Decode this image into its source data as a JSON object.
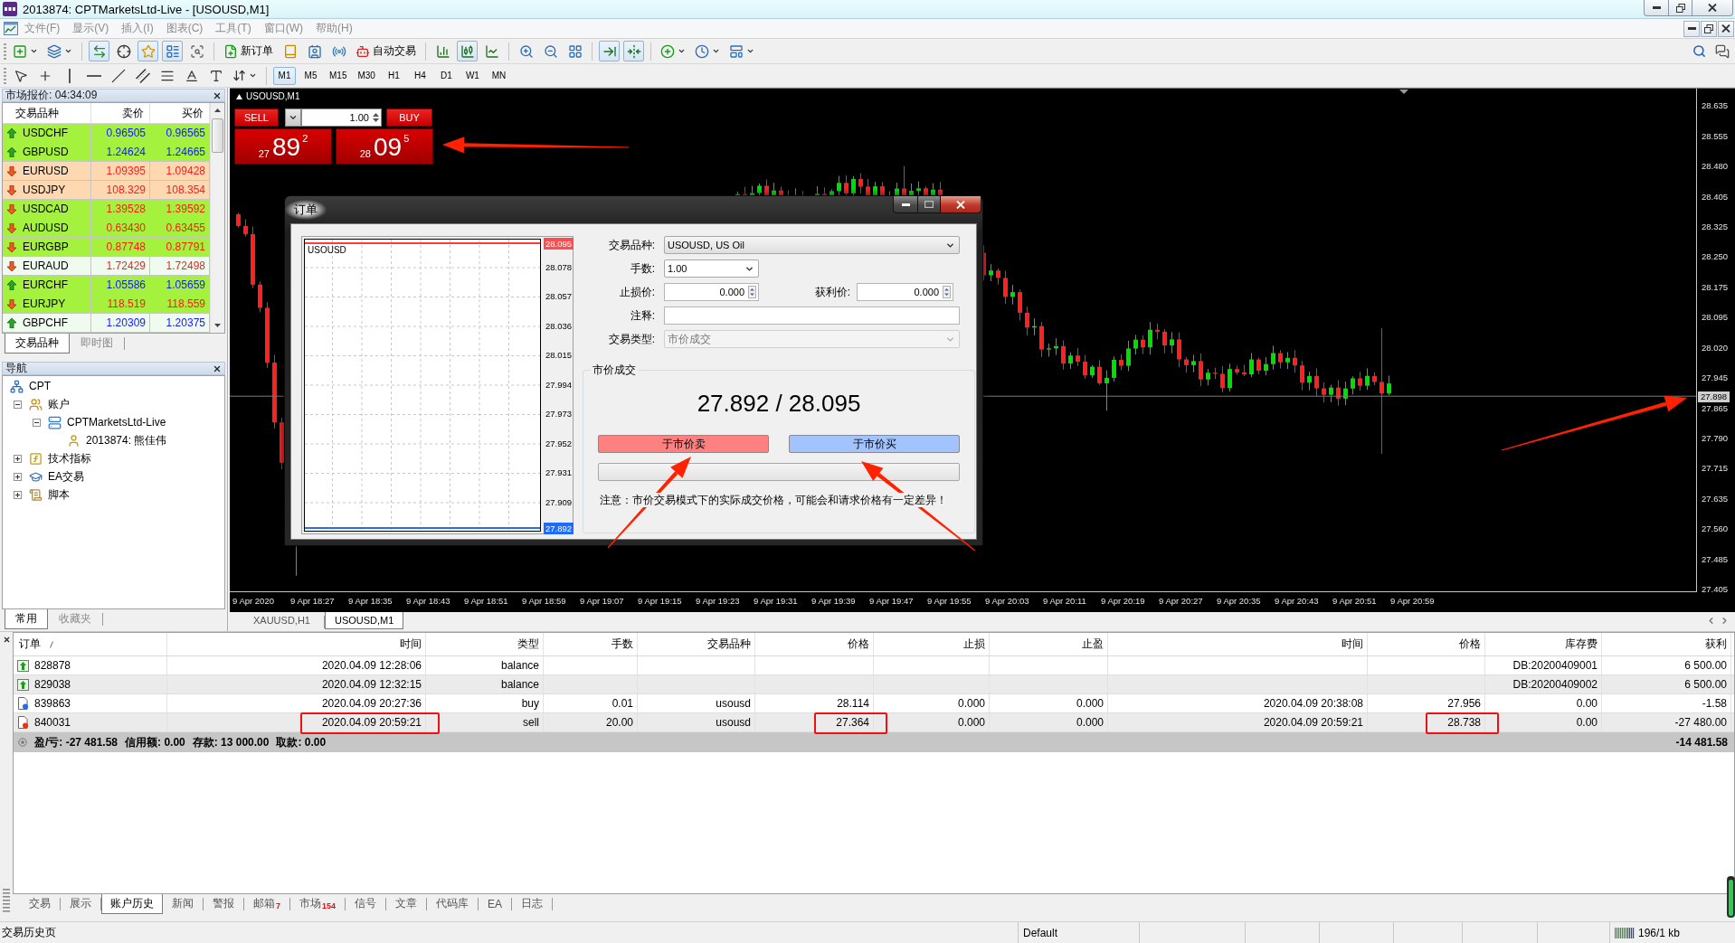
{
  "window": {
    "title": "2013874: CPTMarketsLtd-Live - [USOUSD,M1]"
  },
  "menu": [
    {
      "label": "文件(F)",
      "disabled": true
    },
    {
      "label": "显示(V)",
      "disabled": true
    },
    {
      "label": "插入(I)",
      "disabled": true
    },
    {
      "label": "图表(C)",
      "disabled": true
    },
    {
      "label": "工具(T)",
      "disabled": true
    },
    {
      "label": "窗口(W)",
      "disabled": true
    },
    {
      "label": "帮助(H)",
      "disabled": true
    }
  ],
  "toolbar": {
    "groups": [
      [
        {
          "pressed": false
        },
        {
          "pressed": false
        }
      ],
      [
        {
          "pressed": true
        },
        {
          "pressed": false
        },
        {
          "pressed": true
        },
        {
          "pressed": true
        },
        {
          "pressed": false
        }
      ],
      [
        {
          "label": "新订单",
          "pressed": false
        },
        {
          "pressed": false
        },
        {
          "pressed": false
        },
        {
          "pressed": false
        },
        {
          "label": "自动交易",
          "pressed": false
        }
      ],
      [
        {
          "pressed": false
        },
        {
          "pressed": true
        },
        {
          "pressed": false
        }
      ],
      [
        {
          "pressed": false
        },
        {
          "pressed": false
        },
        {
          "pressed": false
        }
      ],
      [
        {
          "pressed": true
        },
        {
          "pressed": true
        }
      ],
      [
        {
          "pressed": false
        },
        {
          "pressed": false
        },
        {
          "pressed": false
        }
      ]
    ]
  },
  "timeframes": [
    {
      "label": "M1",
      "selected": true
    },
    {
      "label": "M5",
      "selected": false
    },
    {
      "label": "M15",
      "selected": false
    },
    {
      "label": "M30",
      "selected": false
    },
    {
      "label": "H1",
      "selected": false
    },
    {
      "label": "H4",
      "selected": false
    },
    {
      "label": "D1",
      "selected": false
    },
    {
      "label": "W1",
      "selected": false
    },
    {
      "label": "MN",
      "selected": false
    }
  ],
  "market_watch": {
    "title": "市场报价: 04:34:09",
    "columns": [
      "交易品种",
      "卖价",
      "买价"
    ],
    "rows": [
      {
        "symbol": "USDCHF",
        "bid": "0.96505",
        "ask": "0.96565",
        "rising": true,
        "color": "#a4f23e"
      },
      {
        "symbol": "GBPUSD",
        "bid": "1.24624",
        "ask": "1.24665",
        "rising": true,
        "color": "#a4f23e"
      },
      {
        "symbol": "EURUSD",
        "bid": "1.09395",
        "ask": "1.09428",
        "rising": false,
        "color": "#fdd8b0"
      },
      {
        "symbol": "USDJPY",
        "bid": "108.329",
        "ask": "108.354",
        "rising": false,
        "color": "#fdd8b0"
      },
      {
        "symbol": "USDCAD",
        "bid": "1.39528",
        "ask": "1.39592",
        "rising": false,
        "color": "#a4f23e"
      },
      {
        "symbol": "AUDUSD",
        "bid": "0.63430",
        "ask": "0.63455",
        "rising": false,
        "color": "#a4f23e"
      },
      {
        "symbol": "EURGBP",
        "bid": "0.87748",
        "ask": "0.87791",
        "rising": false,
        "color": "#a4f23e"
      },
      {
        "symbol": "EURAUD",
        "bid": "1.72429",
        "ask": "1.72498",
        "rising": false,
        "color": "#f0fbf0"
      },
      {
        "symbol": "EURCHF",
        "bid": "1.05586",
        "ask": "1.05659",
        "rising": true,
        "color": "#a4f23e"
      },
      {
        "symbol": "EURJPY",
        "bid": "118.519",
        "ask": "118.559",
        "rising": false,
        "color": "#a4f23e"
      },
      {
        "symbol": "GBPCHF",
        "bid": "1.20309",
        "ask": "1.20375",
        "rising": true,
        "color": "#f0fbf0"
      }
    ],
    "tabs": [
      {
        "label": "交易品种",
        "selected": true
      },
      {
        "label": "即时图",
        "selected": false
      }
    ]
  },
  "navigator": {
    "title": "导航",
    "tree": [
      {
        "label": "CPT",
        "kind": "network",
        "children": [
          {
            "label": "账户",
            "kind": "accounts",
            "expanded": true,
            "children": [
              {
                "label": "CPTMarketsLtd-Live",
                "kind": "server",
                "expanded": true,
                "children": [
                  {
                    "label": "2013874: 熊佳伟",
                    "kind": "user"
                  }
                ]
              }
            ]
          },
          {
            "label": "技术指标",
            "kind": "indicators",
            "expanded": false
          },
          {
            "label": "EA交易",
            "kind": "experts",
            "expanded": false
          },
          {
            "label": "脚本",
            "kind": "scripts",
            "expanded": false
          }
        ]
      }
    ],
    "tabs": [
      {
        "label": "常用",
        "selected": true
      },
      {
        "label": "收藏夹",
        "selected": false
      }
    ]
  },
  "chart": {
    "title": "USOUSD,M1",
    "price_axis": [
      "28.635",
      "28.555",
      "28.480",
      "28.405",
      "28.325",
      "28.250",
      "28.175",
      "28.095",
      "28.020",
      "27.945",
      "27.865",
      "27.790",
      "27.715",
      "27.635",
      "27.560",
      "27.485",
      "27.405"
    ],
    "current_price": "27.898",
    "time_axis": [
      "9 Apr 2020",
      "9 Apr 18:27",
      "9 Apr 18:35",
      "9 Apr 18:43",
      "9 Apr 18:51",
      "9 Apr 18:59",
      "9 Apr 19:07",
      "9 Apr 19:15",
      "9 Apr 19:23",
      "9 Apr 19:31",
      "9 Apr 19:39",
      "9 Apr 19:47",
      "9 Apr 19:55",
      "9 Apr 20:03",
      "9 Apr 20:11",
      "9 Apr 20:19",
      "9 Apr 20:27",
      "9 Apr 20:35",
      "9 Apr 20:43",
      "9 Apr 20:51",
      "9 Apr 20:59"
    ],
    "one_click": {
      "sell_label": "SELL",
      "buy_label": "BUY",
      "lots": "1.00",
      "sell_quote": {
        "head": "27",
        "big": "89",
        "tail": "2"
      },
      "buy_quote": {
        "head": "28",
        "big": "09",
        "tail": "5"
      }
    }
  },
  "chart_tabs": [
    {
      "label": "XAUUSD,H1",
      "selected": false
    },
    {
      "label": "USOUSD,M1",
      "selected": true
    }
  ],
  "order_dialog": {
    "title": "订单",
    "preview": {
      "symbol": "USOUSD",
      "ask": "28.095",
      "bid": "27.892",
      "labels": [
        "28.078",
        "28.057",
        "28.036",
        "28.015",
        "27.994",
        "27.973",
        "27.952",
        "27.931",
        "27.909"
      ]
    },
    "symbol": {
      "label": "交易品种:",
      "value": "USOUSD, US Oil"
    },
    "volume": {
      "label": "手数:",
      "value": "1.00"
    },
    "stop_loss": {
      "label": "止损价:",
      "value": "0.000"
    },
    "take_profit": {
      "label": "获利价:",
      "value": "0.000"
    },
    "comment": {
      "label": "注释:"
    },
    "order_type": {
      "label": "交易类型:",
      "value": "市价成交",
      "disabled": true
    },
    "market": {
      "title": "市价成交",
      "quote": "27.892 / 28.095",
      "sell_button": "于市价卖",
      "buy_button": "于市价买",
      "note": "注意：市价交易模式下的实际成交价格，可能会和请求价格有一定差异！"
    }
  },
  "terminal": {
    "columns": [
      {
        "label": "订单",
        "sorted": true
      },
      {
        "label": "时间",
        "sorted": false
      },
      {
        "label": "类型",
        "sorted": false
      },
      {
        "label": "手数",
        "sorted": false
      },
      {
        "label": "交易品种",
        "sorted": false
      },
      {
        "label": "价格",
        "sorted": false
      },
      {
        "label": "止损",
        "sorted": false
      },
      {
        "label": "止盈",
        "sorted": false
      },
      {
        "label": "时间",
        "sorted": false
      },
      {
        "label": "价格",
        "sorted": false
      },
      {
        "label": "库存费",
        "sorted": false
      },
      {
        "label": "获利",
        "sorted": false
      }
    ],
    "rows": [
      {
        "kind": "balance",
        "cells": [
          {
            "text": "828878",
            "boxed": false
          },
          {
            "text": "2020.04.09 12:28:06",
            "boxed": false
          },
          {
            "text": "balance",
            "boxed": false
          },
          null,
          null,
          null,
          null,
          null,
          null,
          null,
          {
            "text": "DB:20200409001",
            "boxed": false
          },
          {
            "text": "6 500.00",
            "boxed": false
          }
        ]
      },
      {
        "kind": "balance",
        "cells": [
          {
            "text": "829038",
            "boxed": false
          },
          {
            "text": "2020.04.09 12:32:15",
            "boxed": false
          },
          {
            "text": "balance",
            "boxed": false
          },
          null,
          null,
          null,
          null,
          null,
          null,
          null,
          {
            "text": "DB:20200409002",
            "boxed": false
          },
          {
            "text": "6 500.00",
            "boxed": false
          }
        ]
      },
      {
        "kind": "buy",
        "cells": [
          {
            "text": "839863",
            "boxed": false
          },
          {
            "text": "2020.04.09 20:27:36",
            "boxed": false
          },
          {
            "text": "buy",
            "boxed": false
          },
          {
            "text": "0.01",
            "boxed": false
          },
          {
            "text": "usousd",
            "boxed": false
          },
          {
            "text": "28.114",
            "boxed": false
          },
          {
            "text": "0.000",
            "boxed": false
          },
          {
            "text": "0.000",
            "boxed": false
          },
          {
            "text": "2020.04.09 20:38:08",
            "boxed": false
          },
          {
            "text": "27.956",
            "boxed": false
          },
          {
            "text": "0.00",
            "boxed": false
          },
          {
            "text": "-1.58",
            "boxed": false
          }
        ]
      },
      {
        "kind": "sell",
        "cells": [
          {
            "text": "840031",
            "boxed": false
          },
          {
            "text": "2020.04.09 20:59:21",
            "boxed": true
          },
          {
            "text": "sell",
            "boxed": false
          },
          {
            "text": "20.00",
            "boxed": false
          },
          {
            "text": "usousd",
            "boxed": false
          },
          {
            "text": "27.364",
            "boxed": true
          },
          {
            "text": "0.000",
            "boxed": false
          },
          {
            "text": "0.000",
            "boxed": false
          },
          {
            "text": "2020.04.09 20:59:21",
            "boxed": false
          },
          {
            "text": "28.738",
            "boxed": true
          },
          {
            "text": "0.00",
            "boxed": false
          },
          {
            "text": "-27 480.00",
            "boxed": false
          }
        ]
      }
    ],
    "summary": {
      "parts": [
        "盈/亏: -27 481.58",
        "信用额: 0.00",
        "存款: 13 000.00",
        "取款: 0.00"
      ],
      "total": "-14 481.58"
    },
    "tabs": [
      {
        "label": "交易",
        "selected": false
      },
      {
        "label": "展示",
        "selected": false
      },
      {
        "label": "账户历史",
        "selected": true
      },
      {
        "label": "新闻",
        "selected": false
      },
      {
        "label": "警报",
        "selected": false
      },
      {
        "label": "邮箱",
        "badge": "7",
        "selected": false
      },
      {
        "label": "市场",
        "badge": "154",
        "selected": false
      },
      {
        "label": "信号",
        "selected": false
      },
      {
        "label": "文章",
        "selected": false
      },
      {
        "label": "代码库",
        "selected": false
      },
      {
        "label": "EA",
        "selected": false
      },
      {
        "label": "日志",
        "selected": false
      }
    ]
  },
  "status_bar": {
    "hint": "交易历史页",
    "profile": "Default",
    "traffic": "196/1 kb"
  }
}
